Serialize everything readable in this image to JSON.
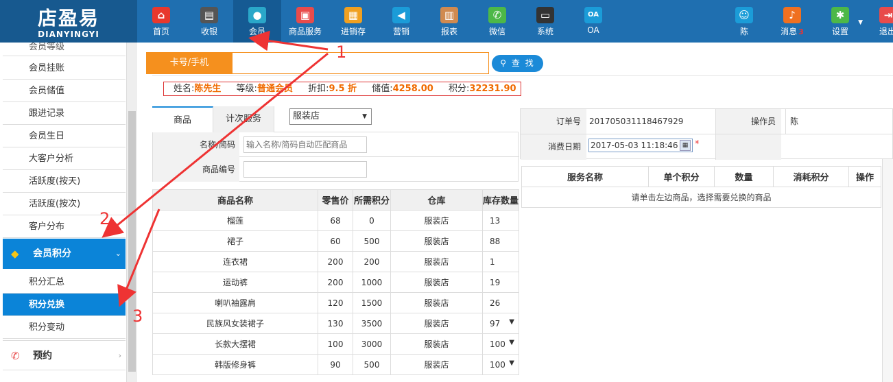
{
  "logo": {
    "cn": "店盈易",
    "en": "DIANYINGYI"
  },
  "nav": [
    {
      "label": "首页",
      "icon": "home-icon",
      "color": "#e8382d",
      "glyph": "⌂"
    },
    {
      "label": "收银",
      "icon": "cash-register-icon",
      "color": "#555555",
      "glyph": "▤"
    },
    {
      "label": "会员",
      "icon": "member-icon",
      "color": "#2aa7c9",
      "glyph": "●"
    },
    {
      "label": "商品服务",
      "icon": "goods-icon",
      "color": "#e84b4b",
      "glyph": "▣"
    },
    {
      "label": "进销存",
      "icon": "inventory-icon",
      "color": "#f0a020",
      "glyph": "▦"
    },
    {
      "label": "营销",
      "icon": "megaphone-icon",
      "color": "#1b9cd8",
      "glyph": "◀"
    },
    {
      "label": "报表",
      "icon": "report-icon",
      "color": "#d08a50",
      "glyph": "▥"
    },
    {
      "label": "微信",
      "icon": "wechat-icon",
      "color": "#4db848",
      "glyph": "✆"
    },
    {
      "label": "系统",
      "icon": "monitor-icon",
      "color": "#333333",
      "glyph": "▭"
    },
    {
      "label": "OA",
      "icon": "oa-icon",
      "color": "#1b9cd8",
      "glyph": "OA"
    }
  ],
  "top_right": {
    "user": {
      "label": "陈",
      "color": "#1b9cd8"
    },
    "messages": {
      "label": "消息",
      "badge": "3",
      "color": "#f07020"
    },
    "settings": {
      "label": "设置",
      "color": "#4db848"
    },
    "logout": {
      "label": "退出",
      "color": "#e84b4b"
    }
  },
  "sidebar": {
    "cut_item": "会员等级",
    "items": [
      "会员挂账",
      "会员储值",
      "跟进记录",
      "会员生日",
      "大客户分析",
      "活跃度(按天)",
      "活跃度(按次)",
      "客户分布"
    ],
    "group_points": "会员积分",
    "sub_items": [
      "积分汇总",
      "积分兑换",
      "积分变动"
    ],
    "group_booking": "预约"
  },
  "search": {
    "label": "卡号/手机",
    "value": "",
    "button": "查 找"
  },
  "member": {
    "name_label": "姓名:",
    "name": "陈先生",
    "level_label": "等级:",
    "level": "普通会员",
    "discount_label": "折扣:",
    "discount": "9.5 折",
    "stored_label": "储值:",
    "stored": "4258.00",
    "points_label": "积分:",
    "points": "32231.90"
  },
  "tabs": {
    "goods": "商品",
    "count_service": "计次服务"
  },
  "store_select": "服装店",
  "form": {
    "name_label": "名称/简码",
    "name_placeholder": "输入名称/简码自动匹配商品",
    "code_label": "商品编号",
    "code_value": ""
  },
  "goods_table": {
    "headers": [
      "商品名称",
      "零售价",
      "所需积分",
      "仓库",
      "库存数量"
    ],
    "rows": [
      {
        "name": "榴莲",
        "price": "68",
        "points": "0",
        "store": "服装店",
        "stock": "13"
      },
      {
        "name": "裙子",
        "price": "60",
        "points": "500",
        "store": "服装店",
        "stock": "88"
      },
      {
        "name": "连衣裙",
        "price": "200",
        "points": "200",
        "store": "服装店",
        "stock": "1"
      },
      {
        "name": "运动裤",
        "price": "200",
        "points": "1000",
        "store": "服装店",
        "stock": "19"
      },
      {
        "name": "喇叭袖露肩",
        "price": "120",
        "points": "1500",
        "store": "服装店",
        "stock": "26"
      },
      {
        "name": "民族风女装裙子",
        "price": "130",
        "points": "3500",
        "store": "服装店",
        "stock": "97"
      },
      {
        "name": "长款大摆裙",
        "price": "100",
        "points": "3000",
        "store": "服装店",
        "stock": "100"
      },
      {
        "name": "韩版修身裤",
        "price": "90",
        "points": "500",
        "store": "服装店",
        "stock": "100"
      }
    ]
  },
  "order": {
    "order_no_label": "订单号",
    "order_no": "201705031118467929",
    "operator_label": "操作员",
    "operator": "陈",
    "date_label": "消费日期",
    "date": "2017-05-03 11:18:46",
    "required": "*"
  },
  "exchange_table": {
    "headers": [
      "服务名称",
      "单个积分",
      "数量",
      "消耗积分",
      "操作"
    ],
    "empty": "请单击左边商品，选择需要兑换的商品"
  },
  "annotations": {
    "n1": "1",
    "n2": "2",
    "n3": "3"
  }
}
